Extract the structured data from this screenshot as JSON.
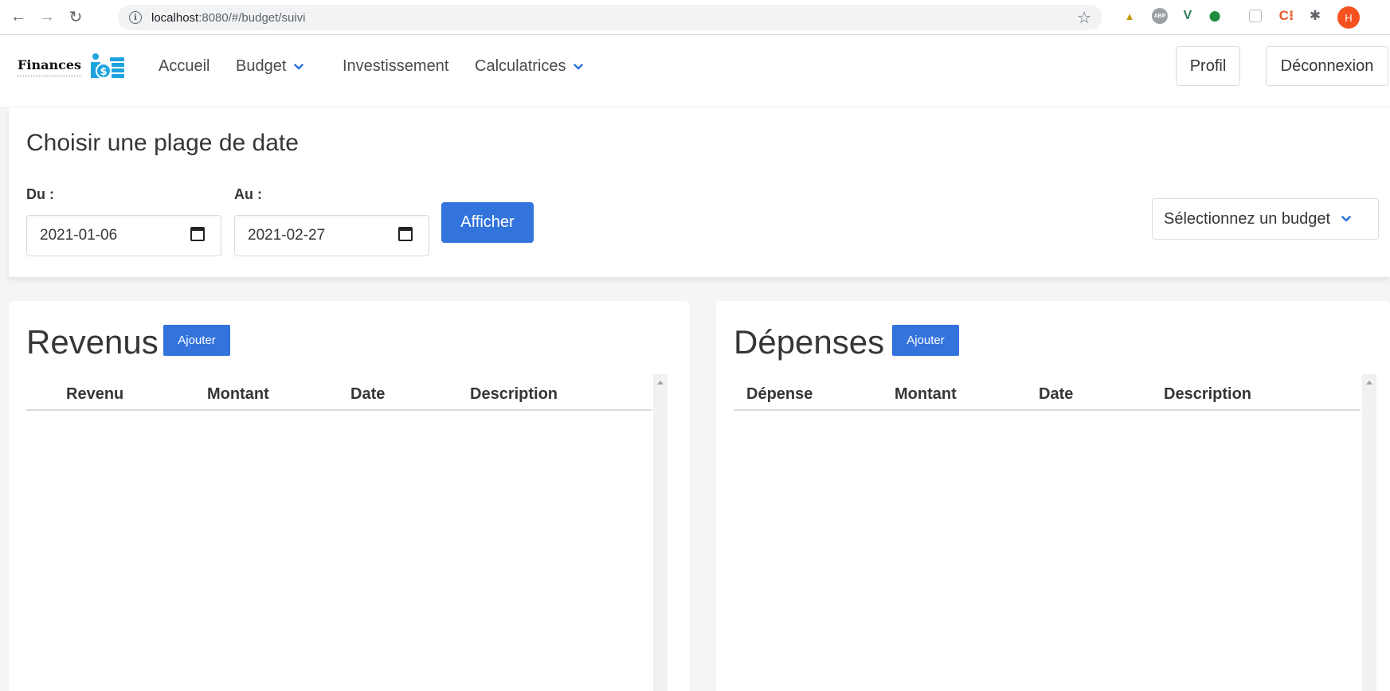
{
  "browser": {
    "url_host": "localhost",
    "url_path": ":8080/#/budget/suivi",
    "avatar_letter": "H",
    "extensions": [
      "flask-icon",
      "adblock-icon",
      "vue-devtools-icon",
      "shield-icon",
      "box-icon",
      "c-icon",
      "puzzle-icon"
    ]
  },
  "navbar": {
    "brand": "Finances",
    "items": [
      {
        "label": "Accueil",
        "dropdown": false
      },
      {
        "label": "Budget",
        "dropdown": true
      },
      {
        "label": "Investissement",
        "dropdown": false
      },
      {
        "label": "Calculatrices",
        "dropdown": true
      }
    ],
    "profile_label": "Profil",
    "logout_label": "Déconnexion"
  },
  "date_range": {
    "title": "Choisir une plage de date",
    "from_label": "Du :",
    "from_value": "2021-01-06",
    "to_label": "Au :",
    "to_value": "2021-02-27",
    "submit_label": "Afficher",
    "budget_select": "Sélectionnez un budget"
  },
  "revenus": {
    "title": "Revenus",
    "add_label": "Ajouter",
    "columns": [
      "Revenu",
      "Montant",
      "Date",
      "Description"
    ],
    "rows": []
  },
  "depenses": {
    "title": "Dépenses",
    "add_label": "Ajouter",
    "columns": [
      "Dépense",
      "Montant",
      "Date",
      "Description"
    ],
    "rows": []
  },
  "colors": {
    "primary": "#3273dc",
    "text": "#363636",
    "background": "#f5f5f5"
  }
}
